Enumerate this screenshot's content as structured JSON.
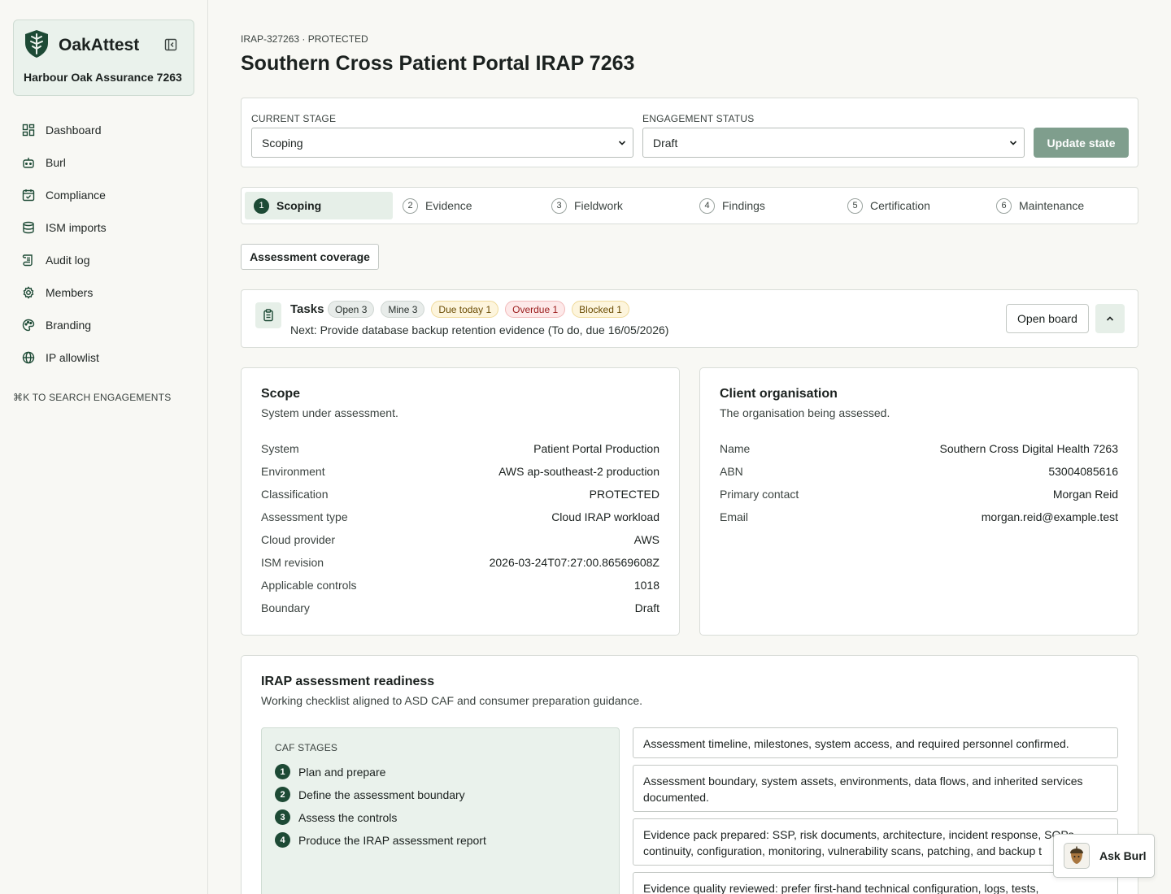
{
  "app": {
    "brand_name": "OakAttest",
    "org_name": "Harbour Oak Assurance 7263",
    "search_hint": "⌘K TO SEARCH ENGAGEMENTS"
  },
  "sidebar": {
    "items": [
      {
        "label": "Dashboard",
        "icon": "dashboard-icon"
      },
      {
        "label": "Burl",
        "icon": "bot-icon"
      },
      {
        "label": "Compliance",
        "icon": "calendar-check-icon"
      },
      {
        "label": "ISM imports",
        "icon": "database-icon"
      },
      {
        "label": "Audit log",
        "icon": "scroll-icon"
      },
      {
        "label": "Members",
        "icon": "gear-icon"
      },
      {
        "label": "Branding",
        "icon": "palette-icon"
      },
      {
        "label": "IP allowlist",
        "icon": "globe-icon"
      }
    ]
  },
  "header": {
    "eyebrow": "IRAP-327263 · PROTECTED",
    "title": "Southern Cross Patient Portal IRAP 7263"
  },
  "state": {
    "stage_label": "CURRENT STAGE",
    "stage_value": "Scoping",
    "status_label": "ENGAGEMENT STATUS",
    "status_value": "Draft",
    "update_label": "Update state"
  },
  "stepper": {
    "steps": [
      {
        "num": "1",
        "label": "Scoping",
        "active": true
      },
      {
        "num": "2",
        "label": "Evidence"
      },
      {
        "num": "3",
        "label": "Fieldwork"
      },
      {
        "num": "4",
        "label": "Findings"
      },
      {
        "num": "5",
        "label": "Certification"
      },
      {
        "num": "6",
        "label": "Maintenance"
      }
    ]
  },
  "coverage_label": "Assessment coverage",
  "tasks": {
    "title": "Tasks",
    "badges": {
      "open": "Open 3",
      "mine": "Mine 3",
      "due": "Due today 1",
      "overdue": "Overdue 1",
      "blocked": "Blocked 1"
    },
    "next": "Next: Provide database backup retention evidence (To do, due 16/05/2026)",
    "open_board": "Open board"
  },
  "scope": {
    "title": "Scope",
    "subtitle": "System under assessment.",
    "rows": [
      {
        "k": "System",
        "v": "Patient Portal Production"
      },
      {
        "k": "Environment",
        "v": "AWS ap-southeast-2 production"
      },
      {
        "k": "Classification",
        "v": "PROTECTED"
      },
      {
        "k": "Assessment type",
        "v": "Cloud IRAP workload"
      },
      {
        "k": "Cloud provider",
        "v": "AWS"
      },
      {
        "k": "ISM revision",
        "v": "2026-03-24T07:27:00.86569608Z"
      },
      {
        "k": "Applicable controls",
        "v": "1018"
      },
      {
        "k": "Boundary",
        "v": "Draft"
      }
    ]
  },
  "client": {
    "title": "Client organisation",
    "subtitle": "The organisation being assessed.",
    "rows": [
      {
        "k": "Name",
        "v": "Southern Cross Digital Health 7263"
      },
      {
        "k": "ABN",
        "v": "53004085616"
      },
      {
        "k": "Primary contact",
        "v": "Morgan Reid"
      },
      {
        "k": "Email",
        "v": "morgan.reid@example.test"
      }
    ]
  },
  "readiness": {
    "title": "IRAP assessment readiness",
    "subtitle": "Working checklist aligned to ASD CAF and consumer preparation guidance.",
    "caf_label": "CAF STAGES",
    "caf_stages": [
      {
        "num": "1",
        "label": "Plan and prepare"
      },
      {
        "num": "2",
        "label": "Define the assessment boundary"
      },
      {
        "num": "3",
        "label": "Assess the controls"
      },
      {
        "num": "4",
        "label": "Produce the IRAP assessment report"
      }
    ],
    "checklist": [
      "Assessment timeline, milestones, system access, and required personnel confirmed.",
      "Assessment boundary, system assets, environments, data flows, and inherited services documented.",
      "Evidence pack prepared: SSP, risk documents, architecture, incident response, SOPs, continuity, configuration, monitoring, vulnerability scans, patching, and backup t",
      "Evidence quality reviewed: prefer first-hand technical configuration, logs, tests,"
    ]
  },
  "ask_burl": "Ask Burl",
  "colors": {
    "accent": "#1d4a35",
    "accent_light": "#e6efe8",
    "update_button": "#7f9e8d"
  }
}
